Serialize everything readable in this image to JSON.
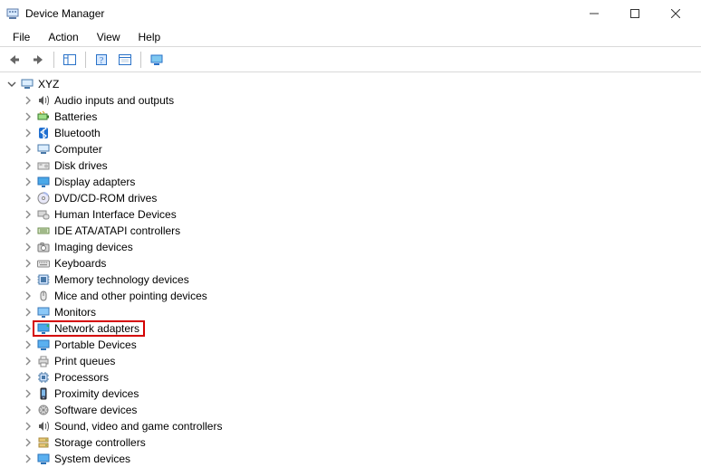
{
  "window": {
    "title": "Device Manager"
  },
  "menu": {
    "file": "File",
    "action": "Action",
    "view": "View",
    "help": "Help"
  },
  "tree": {
    "root": "XYZ",
    "items": [
      "Audio inputs and outputs",
      "Batteries",
      "Bluetooth",
      "Computer",
      "Disk drives",
      "Display adapters",
      "DVD/CD-ROM drives",
      "Human Interface Devices",
      "IDE ATA/ATAPI controllers",
      "Imaging devices",
      "Keyboards",
      "Memory technology devices",
      "Mice and other pointing devices",
      "Monitors",
      "Network adapters",
      "Portable Devices",
      "Print queues",
      "Processors",
      "Proximity devices",
      "Software devices",
      "Sound, video and game controllers",
      "Storage controllers",
      "System devices"
    ],
    "highlighted_index": 14
  }
}
